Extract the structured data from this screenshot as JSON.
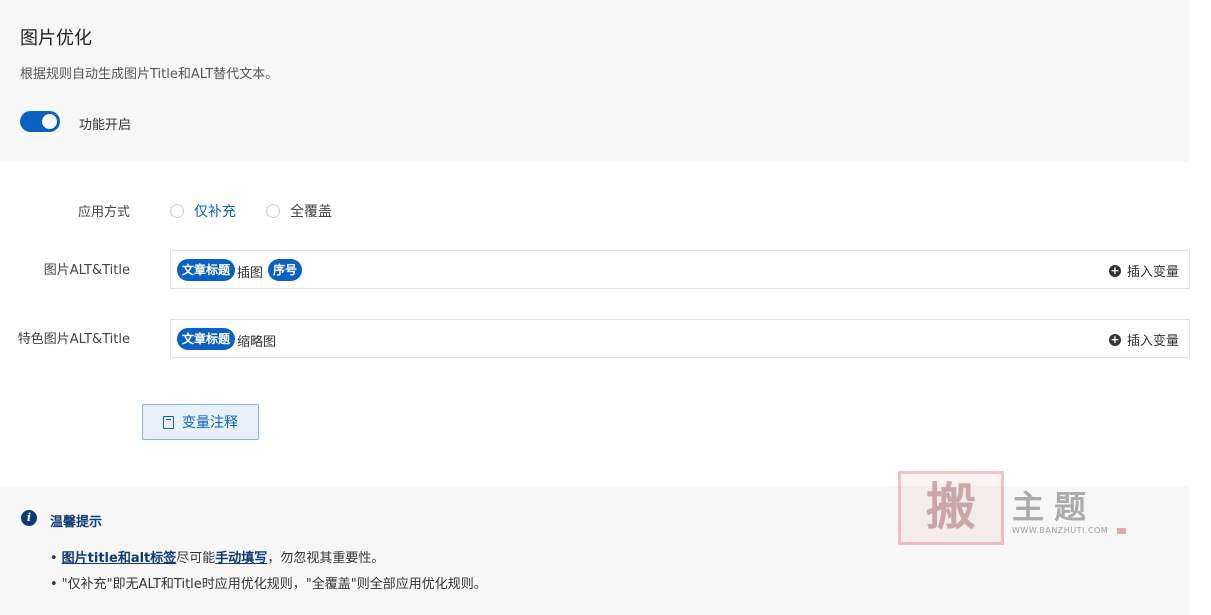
{
  "header": {
    "title": "图片优化",
    "description": "根据规则自动生成图片Title和ALT替代文本。",
    "toggle_label": "功能开启",
    "toggle_on": true
  },
  "apply_mode": {
    "label": "应用方式",
    "options": [
      "仅补充",
      "全覆盖"
    ],
    "selected": "仅补充"
  },
  "image_alt_title": {
    "label": "图片ALT&Title",
    "chip1": "文章标题",
    "text": "插图",
    "chip2": "序号",
    "insert_label": "插入变量"
  },
  "featured_alt_title": {
    "label": "特色图片ALT&Title",
    "chip1": "文章标题",
    "text": "缩略图",
    "insert_label": "插入变量"
  },
  "notes_button": "变量注释",
  "tips": {
    "title": "温馨提示",
    "line1_link1": "图片title和alt标签",
    "line1_text1": "尽可能",
    "line1_link2": "手动填写",
    "line1_text2": "，勿忽视其重要性。",
    "line2": "\"仅补充\"即无ALT和Title时应用优化规则，\"全覆盖\"则全部应用优化规则。"
  },
  "watermark": {
    "seal": "搬",
    "text": "主题",
    "url": "WWW.BANZHUTI.COM"
  },
  "colors": {
    "accent": "#0b61c3",
    "panel_bg": "#f7f7f7",
    "tips_title": "#0d3b78"
  }
}
